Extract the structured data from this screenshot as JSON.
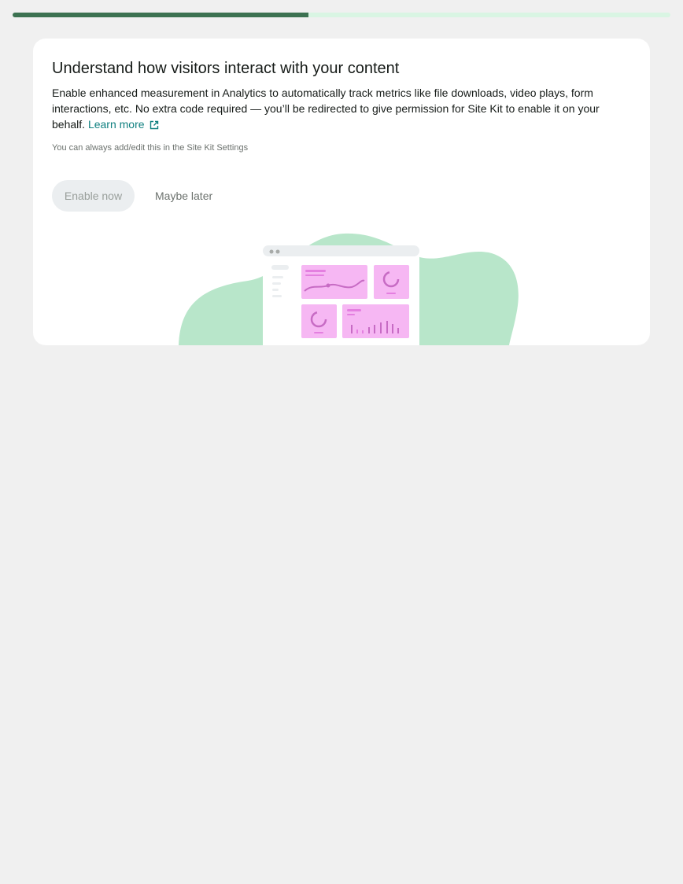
{
  "progress": {
    "fraction": 0.45,
    "fill_color": "#3c7251",
    "track_color": "#d9f5e3"
  },
  "banner": {
    "title": "Understand how visitors interact with your content",
    "description": "Enable enhanced measurement in Analytics to automatically track metrics like file downloads, video plays, form interactions, etc. No extra code required — you’ll be redirected to give permission for Site Kit to enable it on your behalf.",
    "learn_more_label": "Learn more",
    "learn_more_icon": "external-link-icon",
    "helper_text": "You can always add/edit this in the Site Kit Settings",
    "enable_label": "Enable now",
    "later_label": "Maybe later",
    "illustration": "analytics-dashboard-illustration"
  },
  "colors": {
    "link": "#108080",
    "blob": "#b8e6ca",
    "chart_pink": "#f6b7f3",
    "chart_line": "#c76bc4"
  }
}
